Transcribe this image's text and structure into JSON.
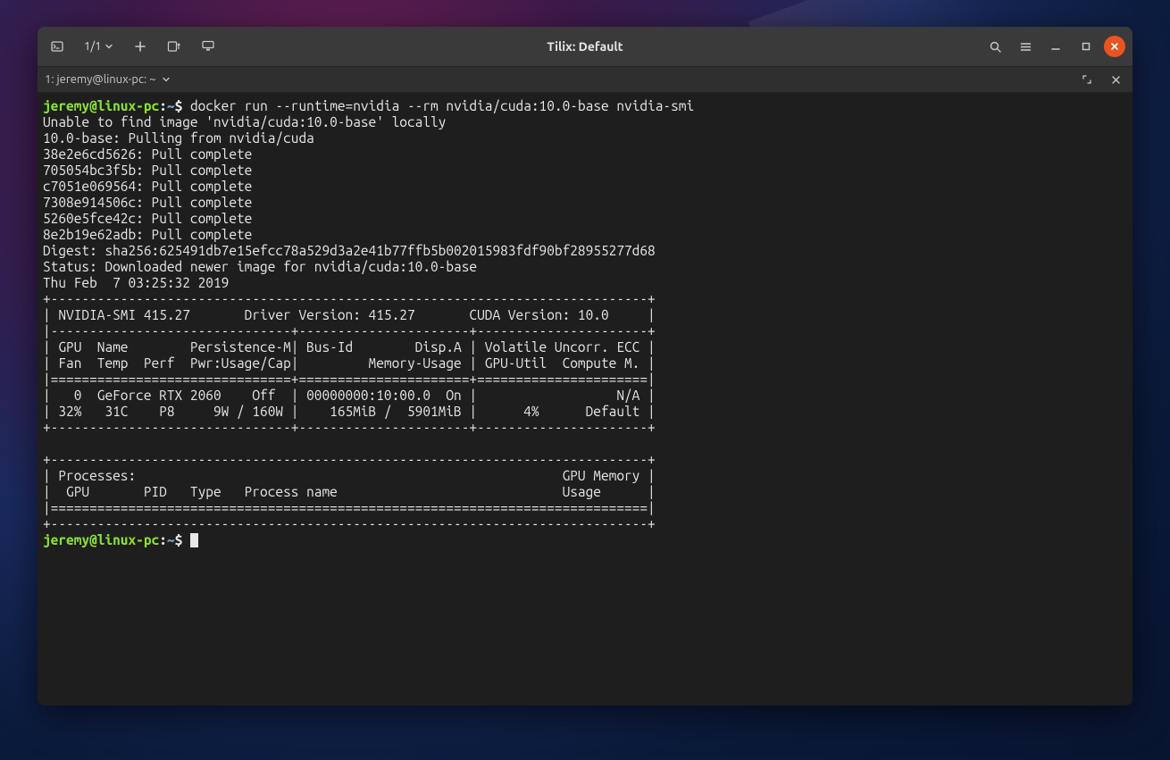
{
  "window": {
    "title": "Tilix: Default",
    "session_indicator": "1/1"
  },
  "tab": {
    "label": "1: jeremy@linux-pc: ~"
  },
  "prompt": {
    "user_host": "jeremy@linux-pc",
    "path": "~",
    "sep": ":",
    "dollar": "$"
  },
  "command": "docker run --runtime=nvidia --rm nvidia/cuda:10.0-base nvidia-smi",
  "output_lines": [
    "Unable to find image 'nvidia/cuda:10.0-base' locally",
    "10.0-base: Pulling from nvidia/cuda",
    "38e2e6cd5626: Pull complete",
    "705054bc3f5b: Pull complete",
    "c7051e069564: Pull complete",
    "7308e914506c: Pull complete",
    "5260e5fce42c: Pull complete",
    "8e2b19e62adb: Pull complete",
    "Digest: sha256:625491db7e15efcc78a529d3a2e41b77ffb5b002015983fdf90bf28955277d68",
    "Status: Downloaded newer image for nvidia/cuda:10.0-base",
    "Thu Feb  7 03:25:32 2019",
    "+-----------------------------------------------------------------------------+",
    "| NVIDIA-SMI 415.27       Driver Version: 415.27       CUDA Version: 10.0     |",
    "|-------------------------------+----------------------+----------------------+",
    "| GPU  Name        Persistence-M| Bus-Id        Disp.A | Volatile Uncorr. ECC |",
    "| Fan  Temp  Perf  Pwr:Usage/Cap|         Memory-Usage | GPU-Util  Compute M. |",
    "|===============================+======================+======================|",
    "|   0  GeForce RTX 2060    Off  | 00000000:10:00.0  On |                  N/A |",
    "| 32%   31C    P8     9W / 160W |    165MiB /  5901MiB |      4%      Default |",
    "+-------------------------------+----------------------+----------------------+",
    "",
    "+-----------------------------------------------------------------------------+",
    "| Processes:                                                       GPU Memory |",
    "|  GPU       PID   Type   Process name                             Usage      |",
    "|=============================================================================|",
    "+-----------------------------------------------------------------------------+"
  ]
}
